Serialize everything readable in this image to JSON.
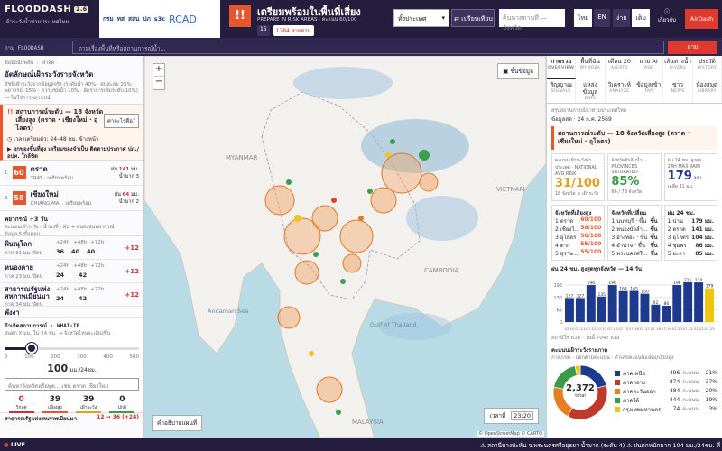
{
  "header": {
    "logo": "FLOODDASH",
    "version": "2.6",
    "subtitle": "เฝ้าระวังน้ำท่วมประเทศไทย",
    "partners": [
      "กรม",
      "ทส",
      "สสน",
      "ปภ",
      "s3c"
    ],
    "rcad": "RCAD",
    "alert_icon": "!!",
    "alert_title": "เตรียมพร้อมในพื้นที่เสี่ยง",
    "alert_sub": "PREPARE IN RISK AREAS · คะแนน 60/100",
    "alert_badge1": "15",
    "alert_badge2": "1784 สายด่วน",
    "country": "ทั้งประเทศ",
    "compare": "เปรียบเทียบ",
    "search_placeholder": "ค้นหาสถานที่ — จังหวัด",
    "lang_th": "ไทย",
    "lang_en": "EN",
    "theme_light": "ง่าย",
    "theme_dark": "เต็ม",
    "about": "เกี่ยวกับ",
    "airdash": "AirDash"
  },
  "ask": {
    "label": "ถาม FLOODASH",
    "placeholder": "ถามเรื่องพื้นที่หรือสถานการณ์น้ำ...",
    "button": "ถาม"
  },
  "left": {
    "eyebrow": "ข้อมือฉับพลัน · ล่าสุด",
    "title": "อัตลักษณ์เฝ้าระวังรายจังหวัด",
    "desc": "ดัชนีเฝ้าระวังจากข้อมูลจริง (ระดับน้ำ 40% · ฝนสะสม 25% · พยากรณ์ 15% · ความชุ่มน้ำ 10% · อัตราการเพิ่มระดับ 10%) — ไม่ใช่การพยากรณ์",
    "situation_title": "สถานการณ์ระดับ — 18 จังหวัดเสี่ยงสูง (ตราด · เชียงใหม่ · อุโลตร)",
    "situation_btn": "ค่าจะไรคือ?",
    "window": "เวลาเตรียมตัว: 24–48 ชม. ข้างหน้า",
    "advice": "ยกของขึ้นที่สูง เตรียมของจำเป็น ติดตามประกาศ ปภ./อปท. ใกล้ชิด",
    "top": [
      {
        "rank": "1",
        "score": "60",
        "color": "#e8562e",
        "name": "ตราด",
        "code": "TRAT · เตรียมพร้อม",
        "n1": "141",
        "u1": "มม.",
        "n2": "3",
        "l1": "ฝน",
        "l2": "น้ำมาก"
      },
      {
        "rank": "2",
        "score": "58",
        "color": "#e8562e",
        "name": "เชียงใหม่",
        "code": "CHIANG MAI · เตรียมพร้อม",
        "n1": "64",
        "u1": "มม.",
        "n2": "2",
        "l1": "ฝน",
        "l2": "น้ำมาก"
      }
    ],
    "forecast_title": "พยากรณ์ +3 วัน",
    "forecast_desc": "คะแนนเฝ้าระวัง · น้ำพงที่ · ฝน + ฝนสะสมพยากรณ์",
    "forecast_note": "ข้อมูล 5 ขั้นตอน",
    "forecasts": [
      {
        "name": "พิษณุโลก",
        "detail": "ภาค 31 มม./อัตน",
        "h": [
          "+24h",
          "+48h",
          "+72h"
        ],
        "v": [
          "36",
          "40",
          "40"
        ],
        "delta": "+12"
      },
      {
        "name": "หนองคาย",
        "detail": "ภาค 23 มม./อัตน",
        "h": [
          "+24h",
          "+48h",
          "+72h"
        ],
        "v": [
          "24",
          "",
          "42"
        ],
        "delta": "+12"
      },
      {
        "name": "สาธารณรัฐแห่งสหภาพเมียนมา",
        "detail": "ภาค 34 มม./อัตน",
        "h": [
          "+24h",
          "+48h",
          "+72h"
        ],
        "v": [
          "24",
          "",
          "42"
        ],
        "delta": "+12"
      },
      {
        "name": "พังงา",
        "detail": "",
        "h": [],
        "v": [],
        "delta": ""
      }
    ],
    "whatif_title": "ถ้าเกิดสถานการณ์ · WHAT-IF",
    "whatif_desc": "ฝนตก X มม. ใน 24 ชม. → จังหวัดไหนจะเสี่ยงขึ้น",
    "slider_ticks": [
      "0",
      "100",
      "200",
      "300",
      "400",
      "500"
    ],
    "slider_fraction": 0.2,
    "whatif_value": "100",
    "whatif_unit": "มม./24ชม.",
    "whatif_input": "ค้นหาจังหวัดหรือพูด... เช่น ตราด เชียงใหม่",
    "stats": [
      {
        "v": "0",
        "l": "วิกฤต",
        "c": "#c33"
      },
      {
        "v": "39",
        "l": "เสี่ยงสูง",
        "c": "#e8562e"
      },
      {
        "v": "39",
        "l": "เฝ้าระวัง",
        "c": "#e0a020"
      },
      {
        "v": "0",
        "l": "ปกติ",
        "c": "#3a9a4a"
      }
    ],
    "foot_name": "สาธารณรัฐแห่งสหภาพเมียนมา",
    "foot_val": "12 → 36 (+24)"
  },
  "map": {
    "layers_btn": "ชั้นข้อมูล",
    "legend_btn": "คำอธิบายแผนที่",
    "map_labels": [
      "MYANMAR",
      "Andaman Sea",
      "Gulf of Thailand",
      "CAMBODIA",
      "MALAYSIA",
      "VIETNAM"
    ],
    "time_prefix": "เวลาที่",
    "time": "23:20",
    "attribution": "© OpenStreetMap © CARTO"
  },
  "right": {
    "tabs": [
      {
        "t": "ภาพรวม",
        "s": "OVERVIEW"
      },
      {
        "t": "พื้นที่ฉัน",
        "s": "MY AREA"
      },
      {
        "t": "เตือน 20",
        "s": "ALERTS"
      },
      {
        "t": "ถาม AI",
        "s": "ASK"
      },
      {
        "t": "เส้นทางน้ำ",
        "s": "RIVERS"
      },
      {
        "t": "ประวัติ",
        "s": "HISTORY"
      },
      {
        "t": "สัญญาณ",
        "s": "SIGNALS"
      },
      {
        "t": "แหล่งข้อมูล",
        "s": "DATA"
      },
      {
        "t": "วิเคราะห์",
        "s": "ANALYZE"
      },
      {
        "t": "ข้อมูลเข้า",
        "s": "TAP"
      },
      {
        "t": "ข่าว",
        "s": "NEWS"
      },
      {
        "t": "ห้องสมุด",
        "s": "LIBRARY"
      }
    ],
    "eyebrow": "สรุปสถานการณ์น้ำท่วมประเทศไทย",
    "date": "ข้อมูลสด · 24 ก.ค. 2569",
    "banner": "สถานการณ์ระดับ — 18 จังหวัดเสี่ยงสูง (ตราด · เชียงใหม่ · อุโลตร)",
    "cards": [
      {
        "label": "คะแนนเฝ้าระวังทั่วประเทศ · NATIONAL AVG RISK",
        "val": "31/100",
        "sub": "18 จังหวัด ≥ เฝ้าระวัง",
        "c": "#e0a020"
      },
      {
        "label": "จังหวัดดินอิ่มน้ำ · PROVINCES SATURATED",
        "val": "85%",
        "sub": "66 / 78 จังหวัด",
        "c": "#3a9a4a"
      },
      {
        "label": "ฝน 24 ชม. สูงสุด · 24H MAX RAIN",
        "val": "179",
        "unit": "มม.",
        "sub": "เฉลี่ย 31 มม.",
        "c": "#1d3a8f"
      }
    ],
    "lists": [
      {
        "title": "จังหวัดที่เสี่ยงสูง",
        "rows": [
          [
            "1",
            "ตราด",
            "60/100"
          ],
          [
            "2",
            "เชียงใ...",
            "58/100"
          ],
          [
            "3",
            "อุโลตร",
            "56/100"
          ],
          [
            "4",
            "ตาก",
            "55/100"
          ],
          [
            "5",
            "สุราษ...",
            "55/100"
          ]
        ]
      },
      {
        "title": "จังหวัดที่เปลี่ยน",
        "rows": [
          [
            "1",
            "นนทบุรี · ขึ้น",
            "ขึ้น"
          ],
          [
            "2",
            "หนองบัวลำ...",
            "ขึ้น"
          ],
          [
            "3",
            "อ่างทอง · ขึ้น",
            "ขึ้น"
          ],
          [
            "4",
            "อำนาจ · ขึ้น",
            "ขึ้น"
          ],
          [
            "5",
            "พระนครศรี...",
            "ขึ้น"
          ]
        ]
      },
      {
        "title": "ฝน 24 ชม.",
        "rows": [
          [
            "1",
            "น่าน",
            "179 มม."
          ],
          [
            "2",
            "ตราด",
            "141 มม."
          ],
          [
            "3",
            "อุโลตร",
            "104 มม."
          ],
          [
            "4",
            "ชุมพร",
            "86 มม."
          ],
          [
            "5",
            "ยะลา",
            "85 มม."
          ]
        ]
      }
    ],
    "chart_title": "ฝน 24 ชม. สูงสุดทุกจังหวัด — 14 วัน",
    "chart_sub": "สถานีใช้ 616 · วันนี้ 7047 แห่ง",
    "pie_title": "คะแนนเฝ้าระวังรายภาค",
    "pie_sub": "ภาค/เขต · แยกตามคะแนน · ตัวเลขคะแนนแสดง/เสี่ยงสูง",
    "pie_total": "2,372",
    "pie_total_label": "total",
    "regions": [
      {
        "n": "ภาคเหนือ",
        "v": "496",
        "u": "คะแนน",
        "p": "21%",
        "c": "#1d3a8f"
      },
      {
        "n": "ภาคกลาง",
        "v": "874",
        "u": "คะแนน",
        "p": "37%",
        "c": "#c0392b"
      },
      {
        "n": "ภาคตะวันออก",
        "v": "484",
        "u": "คะแนน",
        "p": "20%",
        "c": "#e67e22"
      },
      {
        "n": "ภาคใต้",
        "v": "444",
        "u": "คะแนน",
        "p": "19%",
        "c": "#3a9a4a"
      },
      {
        "n": "กรุงเทพมหานคร",
        "v": "74",
        "u": "คะแนน",
        "p": "3%",
        "c": "#f1c40f"
      }
    ]
  },
  "bottom": {
    "live": "LIVE",
    "ticker": "⚠ สถานีบางปะหัน จ.พระนครศรีอยุธยา น้ำมาก (ระดับ 4)     ⚠ ฝนตกหนักมาก 104 มม./24ชม. ที่"
  },
  "chart_data": {
    "type": "bar",
    "title": "ฝน 24 ชม. สูงสุดทุกจังหวัด — 14 วัน",
    "ylabel": "มม.",
    "categories": [
      "07-10",
      "07-11",
      "07-12",
      "07-13",
      "07-14",
      "07-15",
      "07-16",
      "07-17",
      "07-18",
      "07-19",
      "07-20",
      "07-21",
      "07-22",
      "07-23"
    ],
    "values": [
      127,
      127,
      196,
      135,
      196,
      164,
      165,
      150,
      92,
      86,
      196,
      211,
      210,
      179
    ],
    "highlight_index": 13,
    "color": "#1d3a8f",
    "highlight_color": "#f1c40f"
  }
}
